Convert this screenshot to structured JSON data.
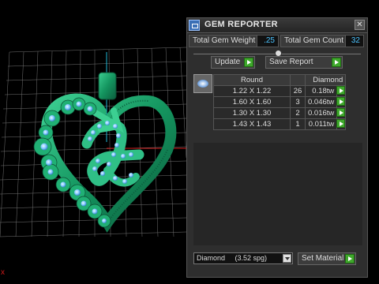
{
  "panel": {
    "title": "GEM REPORTER",
    "close_icon": "close-icon",
    "total_weight_label": "Total Gem Weight",
    "total_weight_value": ".25",
    "total_count_label": "Total Gem Count",
    "total_count_value": "32",
    "update_label": "Update",
    "save_report_label": "Save Report",
    "table": {
      "headers": [
        "Round",
        "",
        "Diamond"
      ],
      "rows": [
        {
          "size": "1.22 X 1.22",
          "count": "26",
          "weight": "0.18tw"
        },
        {
          "size": "1.60 X 1.60",
          "count": "3",
          "weight": "0.046tw"
        },
        {
          "size": "1.30 X 1.30",
          "count": "2",
          "weight": "0.016tw"
        },
        {
          "size": "1.43 X 1.43",
          "count": "1",
          "weight": "0.011tw"
        }
      ]
    },
    "material_select": "Diamond     (3.52 spg)",
    "set_material_label": "Set Material"
  },
  "colors": {
    "panel_bg": "#2e2e2e",
    "value_text": "#4cc3ff",
    "go_button": "#3fa82c",
    "model": "#1fa36d",
    "gems": "#7ec8ff",
    "grid": "#bdbdbd",
    "axis_x": "#d11a1a",
    "axis_y": "#1fb7d6"
  },
  "viewport": {
    "corner_axis_label": "x"
  }
}
